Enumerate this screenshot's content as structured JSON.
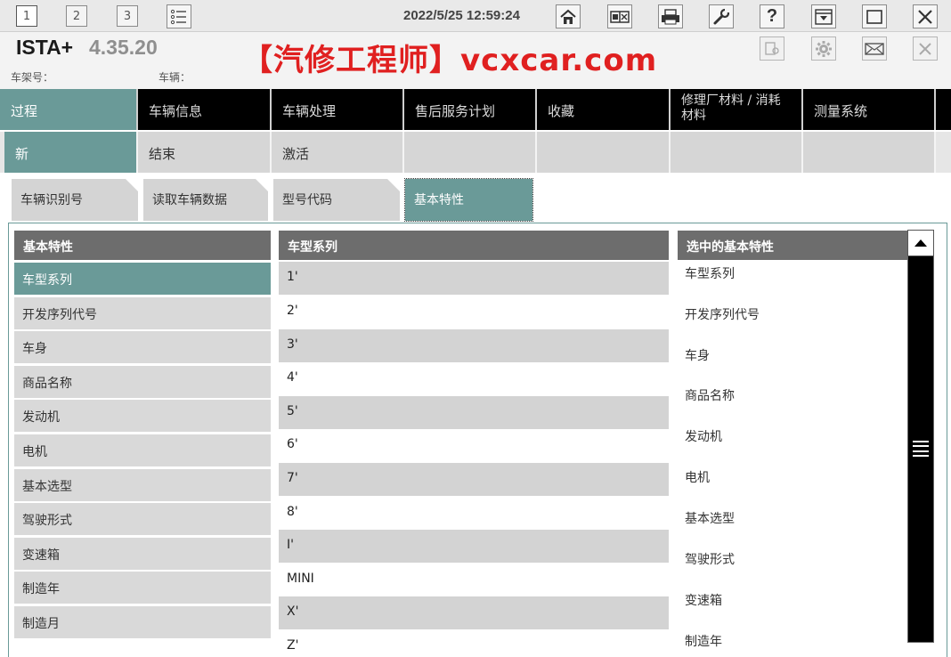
{
  "toolbar": {
    "window_tabs": [
      "1",
      "2",
      "3"
    ],
    "datetime": "2022/5/25 12:59:24",
    "help_label": "?"
  },
  "header": {
    "app_name": "ISTA+",
    "version": "4.35.20",
    "watermark": "【汽修工程师】vcxcar.com",
    "vin_label": "车架号：",
    "vehicle_label": "车辆："
  },
  "nav_main": [
    "过程",
    "车辆信息",
    "车辆处理",
    "售后服务计划",
    "收藏",
    "修理厂材料 / 消耗材料",
    "测量系统"
  ],
  "nav_sub": [
    "新",
    "结束",
    "激活"
  ],
  "sub_tabs": [
    "车辆识别号",
    "读取车辆数据",
    "型号代码",
    "基本特性"
  ],
  "columns": {
    "characteristics_header": "基本特性",
    "series_header": "车型系列",
    "selected_header": "选中的基本特性"
  },
  "characteristics": [
    "车型系列",
    "开发序列代号",
    "车身",
    "商品名称",
    "发动机",
    "电机",
    "基本选型",
    "驾驶形式",
    "变速箱",
    "制造年",
    "制造月"
  ],
  "series": [
    "1'",
    "2'",
    "3'",
    "4'",
    "5'",
    "6'",
    "7'",
    "8'",
    "I'",
    "MINI",
    "X'",
    "Z'"
  ],
  "selected_characteristics": [
    "车型系列",
    "开发序列代号",
    "车身",
    "商品名称",
    "发动机",
    "电机",
    "基本选型",
    "驾驶形式",
    "变速箱",
    "制造年"
  ],
  "colors": {
    "accent": "#6a9a98",
    "nav_bg": "#000000",
    "header_bg": "#6d6d6d",
    "watermark": "#e02020"
  }
}
